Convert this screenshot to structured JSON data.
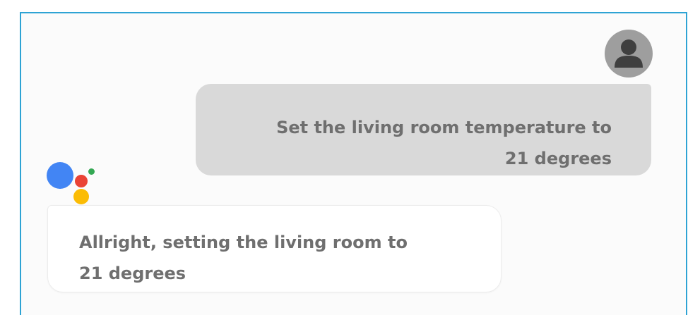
{
  "conversation": {
    "user_message": "Set the living room temperature to 21 degrees",
    "assistant_message": "Allright, setting the living room to 21 degrees"
  },
  "icons": {
    "user_avatar": "person-icon",
    "assistant_logo": "google-assistant-dots-icon"
  },
  "colors": {
    "frame_border": "#2ea3d4",
    "user_bubble": "#d9d9d9",
    "avatar": "#9e9e9e",
    "text": "#6f6f6f",
    "assistant_blue": "#4285f4",
    "assistant_red": "#ea4335",
    "assistant_green": "#34a853",
    "assistant_yellow": "#fbbc05"
  }
}
